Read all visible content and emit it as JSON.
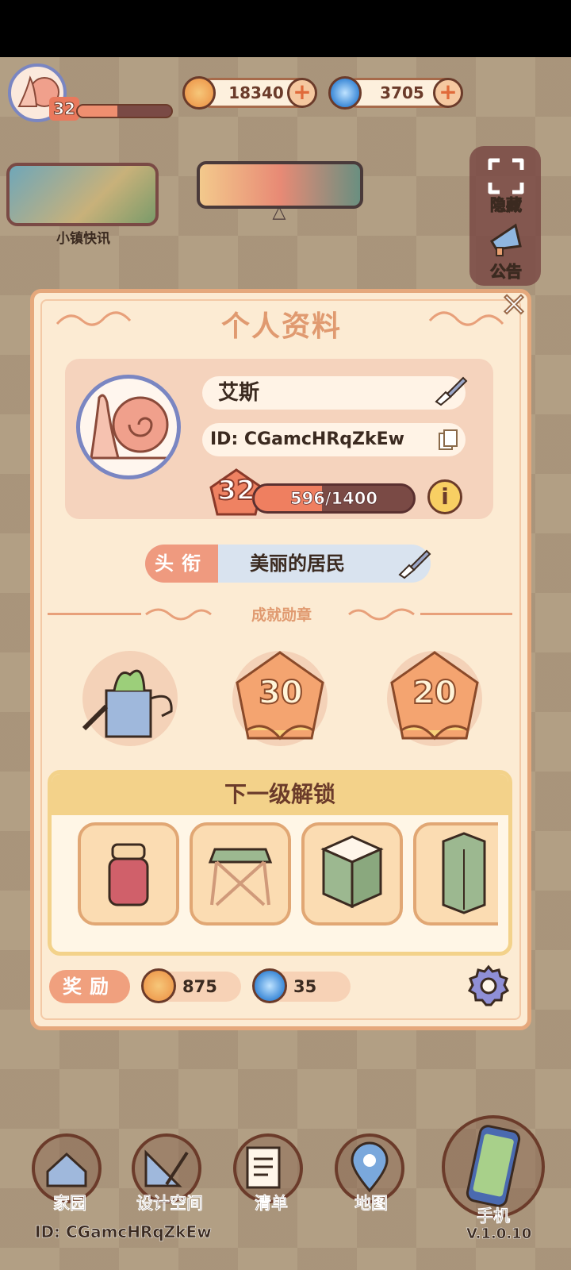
{
  "hud": {
    "level": "32",
    "xp_fraction": 0.42,
    "coins": "18340",
    "gems": "3705"
  },
  "top": {
    "news_label": "小镇快讯",
    "hide_label": "隐藏",
    "notice_label": "公告"
  },
  "profile": {
    "title": "个人资料",
    "name": "艾斯",
    "id_text": "ID: CGamcHRqZkEw",
    "level": "32",
    "xp_text": "596/1400",
    "xp_fraction": 0.4257,
    "title_tag": "头衔",
    "title_value": "美丽的居民",
    "achievements_label": "成就勋章",
    "badges": [
      {
        "icon": "watering-can"
      },
      {
        "number": "30"
      },
      {
        "number": "20"
      }
    ],
    "unlock_title": "下一级解锁",
    "unlock_items": [
      "jam-jar",
      "stool",
      "cabinet",
      "wardrobe"
    ],
    "reward_label": "奖励",
    "reward_coins": "875",
    "reward_gems": "35"
  },
  "nav": {
    "home": "家园",
    "design": "设计空间",
    "list": "清单",
    "map": "地图",
    "phone": "手机"
  },
  "footer": {
    "id_text": "ID: CGamcHRqZkEw",
    "version": "V.1.0.10"
  },
  "colors": {
    "modal_bg": "#fcebd3",
    "accent": "#e09a70",
    "xp_fill": "#ef7f60"
  }
}
